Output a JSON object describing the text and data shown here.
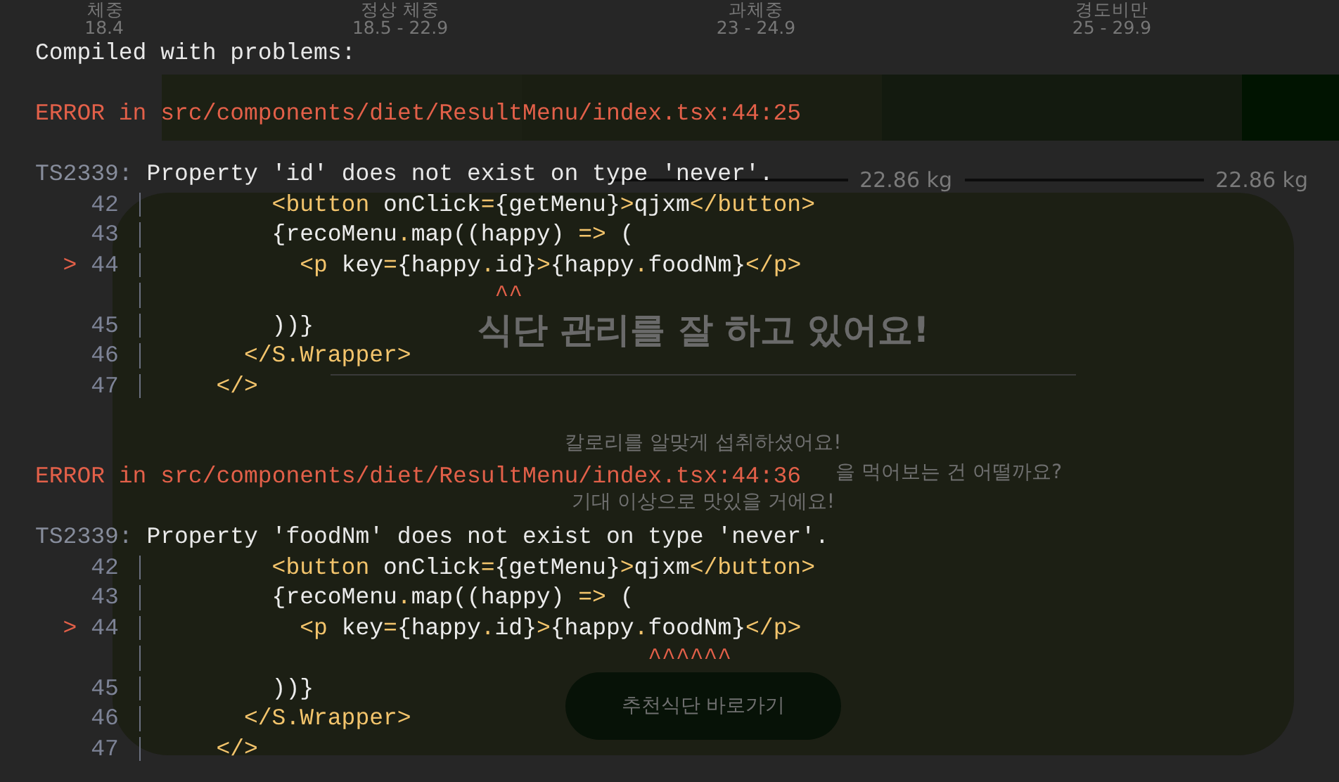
{
  "page": {
    "bmi_scale": [
      {
        "label": "체중",
        "range": "18.4"
      },
      {
        "label": "정상 체중",
        "range": "18.5 - 22.9"
      },
      {
        "label": "과체중",
        "range": "23 - 24.9"
      },
      {
        "label": "경도비만",
        "range": "25 - 29.9"
      }
    ],
    "bmi_bar": [
      {
        "color": "#1c2014"
      },
      {
        "color": "#1a1e12"
      },
      {
        "color": "#131a0f"
      },
      {
        "color": "#011401"
      }
    ],
    "weights": [
      "22.86 kg",
      "22.86 kg"
    ],
    "card": {
      "title": "식단 관리를 잘 하고 있어요!",
      "messages": [
        "칼로리를 알맞게 섭취하셨어요!",
        "을 먹어보는 건 어떨까요?",
        "기대 이상으로 맛있을 거에요!"
      ],
      "button": "추천식단 바로가기"
    }
  },
  "error_overlay": {
    "heading": "Compiled with problems:",
    "errors": [
      {
        "location": "ERROR in src/components/diet/ResultMenu/index.tsx:44:25",
        "code": "TS2339:",
        "message": "Property 'id' does not exist on type 'never'.",
        "lines": [
          {
            "kind": "code",
            "number": "42",
            "text": "        <button onClick={getMenu}>qjxm</button>"
          },
          {
            "kind": "code",
            "number": "43",
            "text": "        {recoMenu.map((happy) => ("
          },
          {
            "kind": "code",
            "number": "44",
            "pointer": ">",
            "text": "          <p key={happy.id}>{happy.foodNm}</p>"
          },
          {
            "kind": "caret",
            "text": "                        ^^"
          },
          {
            "kind": "code",
            "number": "45",
            "text": "        ))}"
          },
          {
            "kind": "code",
            "number": "46",
            "text": "      </S.Wrapper>"
          },
          {
            "kind": "code",
            "number": "47",
            "text": "    </>"
          }
        ]
      },
      {
        "location": "ERROR in src/components/diet/ResultMenu/index.tsx:44:36",
        "code": "TS2339:",
        "message": "Property 'foodNm' does not exist on type 'never'.",
        "lines": [
          {
            "kind": "code",
            "number": "42",
            "text": "        <button onClick={getMenu}>qjxm</button>"
          },
          {
            "kind": "code",
            "number": "43",
            "text": "        {recoMenu.map((happy) => ("
          },
          {
            "kind": "code",
            "number": "44",
            "pointer": ">",
            "text": "          <p key={happy.id}>{happy.foodNm}</p>"
          },
          {
            "kind": "caret",
            "text": "                                   ^^^^^^"
          },
          {
            "kind": "code",
            "number": "45",
            "text": "        ))}"
          },
          {
            "kind": "code",
            "number": "46",
            "text": "      </S.Wrapper>"
          },
          {
            "kind": "code",
            "number": "47",
            "text": "    </>"
          }
        ]
      }
    ]
  }
}
